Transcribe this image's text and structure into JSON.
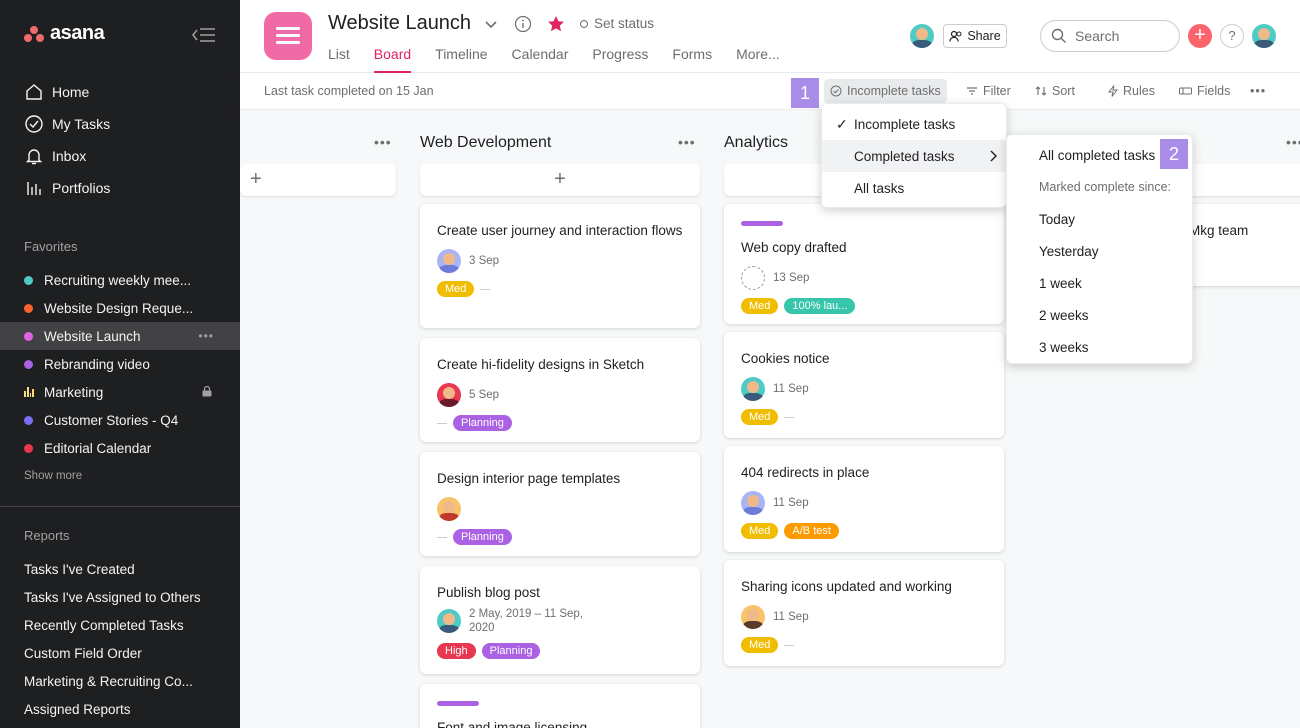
{
  "app": {
    "name": "asana"
  },
  "sidebar": {
    "nav": [
      {
        "label": "Home",
        "icon": "home-icon"
      },
      {
        "label": "My Tasks",
        "icon": "check-circle-icon"
      },
      {
        "label": "Inbox",
        "icon": "bell-icon"
      },
      {
        "label": "Portfolios",
        "icon": "bar-chart-icon"
      }
    ],
    "favorites_label": "Favorites",
    "favorites": [
      {
        "label": "Recruiting weekly mee...",
        "color": "#4ecbc4"
      },
      {
        "label": "Website Design Reque...",
        "color": "#fd612c"
      },
      {
        "label": "Website Launch",
        "color": "#e362e3"
      },
      {
        "label": "Rebranding video",
        "color": "#aa62e3"
      },
      {
        "label": "Marketing",
        "color": "#f8df72"
      },
      {
        "label": "Customer Stories - Q4",
        "color": "#7a6ff0"
      },
      {
        "label": "Editorial Calendar",
        "color": "#e8384f"
      }
    ],
    "favorite_more": "•••",
    "show_more": "Show more",
    "reports_label": "Reports",
    "reports": [
      "Tasks I've Created",
      "Tasks I've Assigned to Others",
      "Recently Completed Tasks",
      "Custom Field Order",
      "Marketing & Recruiting Co...",
      "Assigned Reports"
    ]
  },
  "header": {
    "title": "Website Launch",
    "set_status": "Set status",
    "tabs": [
      "List",
      "Board",
      "Timeline",
      "Calendar",
      "Progress",
      "Forms",
      "More..."
    ],
    "active_tab": "Board",
    "share": "Share",
    "search_placeholder": "Search",
    "help": "?",
    "plus": "+"
  },
  "toolbar": {
    "last_completed": "Last task completed on 15 Jan",
    "incomplete": "Incomplete tasks",
    "filter": "Filter",
    "sort": "Sort",
    "rules": "Rules",
    "fields": "Fields",
    "more": "•••",
    "step1": "1",
    "step2": "2"
  },
  "columns": [
    {
      "title": "",
      "more": "•••",
      "add": "+"
    },
    {
      "title": "Web Development",
      "more": "•••",
      "add": "+"
    },
    {
      "title": "Analytics",
      "more": "•••",
      "add": "+"
    },
    {
      "title": "",
      "more": "•••",
      "add": "+"
    }
  ],
  "cards": {
    "web_dev": [
      {
        "title": "Create user journey and interaction flows",
        "date": "3 Sep",
        "tags": [
          {
            "label": "Med",
            "color": "#f1bd00"
          }
        ]
      },
      {
        "title": "Create hi-fidelity designs in Sketch",
        "date": "5 Sep",
        "tags": [
          {
            "label": "Planning",
            "color": "#aa62e3"
          }
        ]
      },
      {
        "title": "Design interior page templates",
        "date": "",
        "tags": [
          {
            "label": "Planning",
            "color": "#aa62e3"
          }
        ]
      },
      {
        "title": "Publish blog post",
        "date": "2 May, 2019 – 11 Sep, 2020",
        "tags": [
          {
            "label": "High",
            "color": "#e8384f"
          },
          {
            "label": "Planning",
            "color": "#aa62e3"
          }
        ]
      },
      {
        "title": "Font and image licensing",
        "date": "",
        "tags": []
      }
    ],
    "analytics": [
      {
        "title": "Web copy drafted",
        "date": "13 Sep",
        "tags": [
          {
            "label": "Med",
            "color": "#f1bd00"
          },
          {
            "label": "100% lau...",
            "color": "#37c5ab"
          }
        ]
      },
      {
        "title": "Cookies notice",
        "date": "11 Sep",
        "tags": [
          {
            "label": "Med",
            "color": "#f1bd00"
          }
        ]
      },
      {
        "title": "404 redirects in place",
        "date": "11 Sep",
        "tags": [
          {
            "label": "Med",
            "color": "#f1bd00"
          },
          {
            "label": "A/B test",
            "color": "#fd9a00"
          }
        ]
      },
      {
        "title": "Sharing icons updated and working",
        "date": "11 Sep",
        "tags": [
          {
            "label": "Med",
            "color": "#f1bd00"
          }
        ]
      }
    ],
    "right_partial": "Mkg team"
  },
  "menu1": {
    "items": [
      "Incomplete tasks",
      "Completed tasks",
      "All tasks"
    ],
    "check": "✓"
  },
  "menu2": {
    "all_completed": "All completed tasks",
    "since_label": "Marked complete since:",
    "options": [
      "Today",
      "Yesterday",
      "1 week",
      "2 weeks",
      "3 weeks"
    ]
  }
}
